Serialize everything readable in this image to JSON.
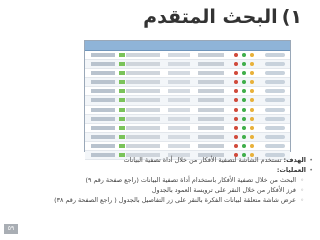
{
  "slide": {
    "number_label": "١)",
    "title": "البحث المتقدم",
    "objective_label": "الهدف:",
    "objective_text": "تستخدم الشاشة لتصفية الأفكار من خلال أداة تصفية البيانات",
    "operations_label": "العمليات:",
    "operations": [
      "البحث من خلال تصفية الأفكار باستخدام أداة تصفية البيانات (راجع صفحة رقم ٩)",
      "فرز الأفكار من خلال النقر على ترويسة العمود بالجدول",
      "عرض شاشة متعلقة لبيانات الفكرة بالنقر على زر التفاصيل بالجدول ( راجع الصفحة رقم ٣٨)"
    ],
    "page_number": "٥٩"
  }
}
